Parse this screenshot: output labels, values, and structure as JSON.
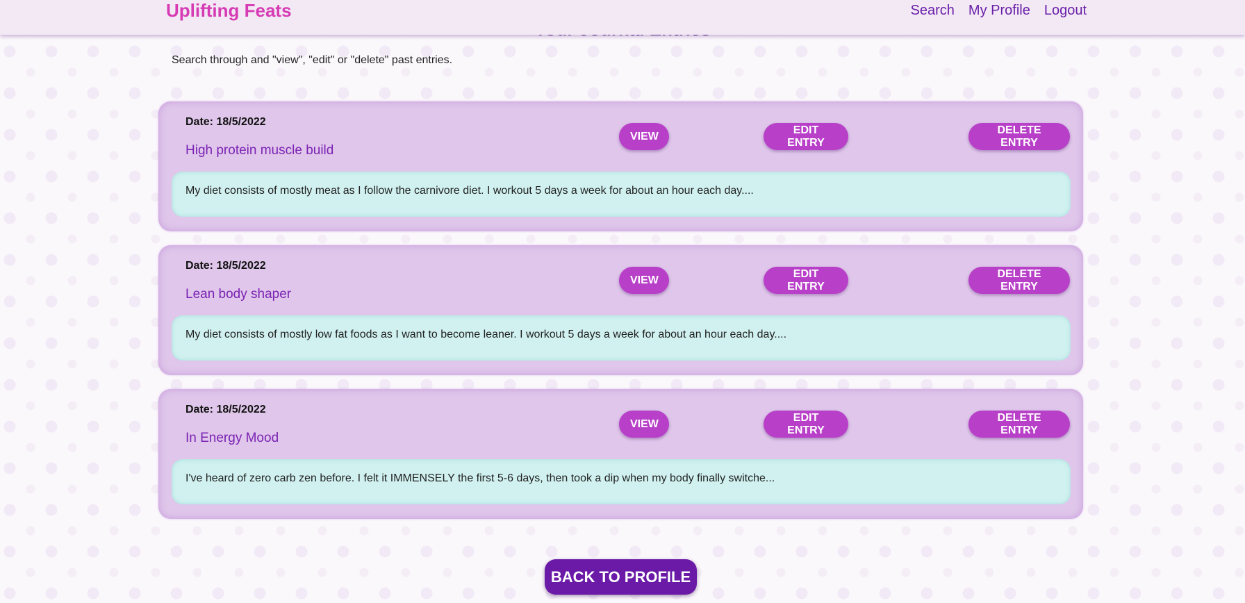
{
  "nav": {
    "brand": "Uplifting Feats",
    "links": [
      "Search",
      "My Profile",
      "Logout"
    ]
  },
  "page": {
    "title": "Your Journal Entries",
    "instructions": "Search through and \"view\", \"edit\" or \"delete\" past entries."
  },
  "buttons": {
    "view": "VIEW",
    "edit": "EDIT ENTRY",
    "delete": "DELETE ENTRY",
    "back": "BACK TO PROFILE"
  },
  "entries": [
    {
      "date": "Date: 18/5/2022",
      "title": "High protein muscle build",
      "text": "My diet consists of mostly meat as I follow the carnivore diet. I workout 5 days a week for about an hour each day...."
    },
    {
      "date": "Date: 18/5/2022",
      "title": "Lean body shaper",
      "text": "My diet consists of mostly low fat foods as I want to become leaner. I workout 5 days a week for about an hour each day...."
    },
    {
      "date": "Date: 18/5/2022",
      "title": "In Energy Mood",
      "text": "I've heard of zero carb zen before. I felt it IMMENSELY the first 5-6 days, then took a dip when my body finally switche..."
    }
  ],
  "colors": {
    "brand": "#d63bb4",
    "nav_link": "#6a1fa8",
    "card_bg": "#dfc6ea",
    "card_body_bg": "#d0f1f0",
    "button_bg": "#b83fc8",
    "back_button_bg": "#6a1aa6"
  }
}
